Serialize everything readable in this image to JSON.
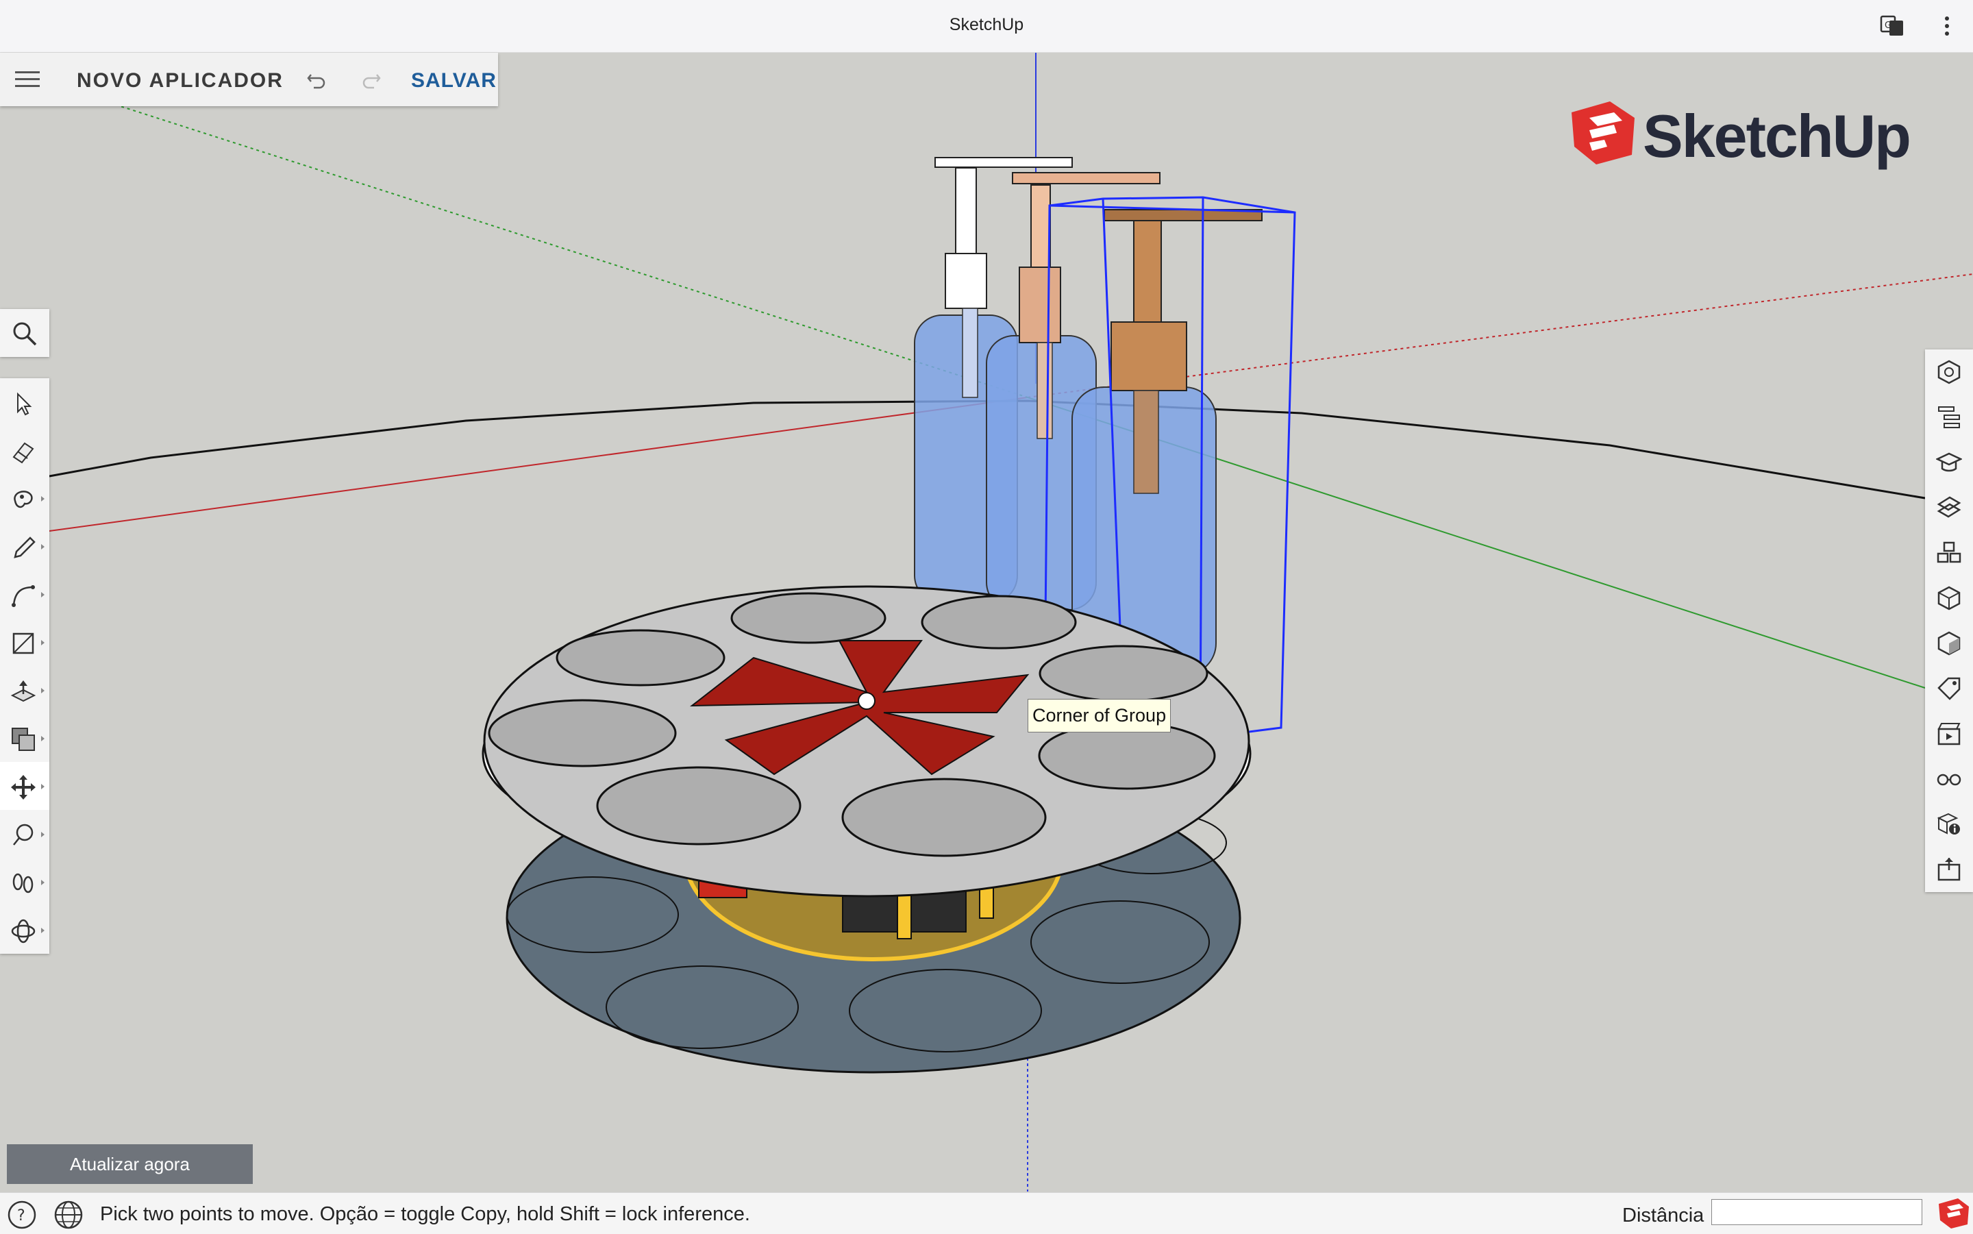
{
  "window": {
    "title": "SketchUp"
  },
  "toolbar": {
    "document_title": "NOVO APLICADOR",
    "save_label": "SALVAR",
    "menu_icon": "hamburger-menu-icon",
    "undo_icon": "undo-icon",
    "redo_icon": "redo-icon"
  },
  "logo": {
    "wordmark": "SketchUp"
  },
  "left_tools": {
    "search": "search-icon",
    "items": [
      {
        "name": "select-tool",
        "icon": "arrow-icon"
      },
      {
        "name": "eraser-tool",
        "icon": "eraser-icon"
      },
      {
        "name": "paint-bucket-tool",
        "icon": "paint-icon"
      },
      {
        "name": "pencil-tool",
        "icon": "pencil-icon"
      },
      {
        "name": "arc-tool",
        "icon": "arc-icon"
      },
      {
        "name": "rectangle-tool",
        "icon": "rectangle-icon"
      },
      {
        "name": "push-pull-tool",
        "icon": "push-pull-icon"
      },
      {
        "name": "offset-tool",
        "icon": "offset-icon"
      },
      {
        "name": "move-tool",
        "icon": "move-icon",
        "active": true
      },
      {
        "name": "tape-measure-tool",
        "icon": "tape-icon"
      },
      {
        "name": "walk-tool",
        "icon": "footprints-icon"
      },
      {
        "name": "orbit-tool",
        "icon": "orbit-icon"
      }
    ]
  },
  "right_panels": [
    "entity-info-icon",
    "outliner-icon",
    "instructor-icon",
    "materials-icon",
    "components-icon",
    "styles-icon",
    "shadows-icon",
    "tags-icon",
    "scenes-icon",
    "display-icon",
    "model-info-icon",
    "export-icon"
  ],
  "tooltip": {
    "text": "Corner of Group"
  },
  "update_button": {
    "label": "Atualizar agora"
  },
  "statusbar": {
    "message": "Pick two points to move. Opção = toggle Copy, hold Shift = lock inference.",
    "distance_label": "Distância",
    "distance_value": ""
  },
  "colors": {
    "accent": "#1f5d9a",
    "axis_red": "#c0262b",
    "axis_green": "#2f9a2f",
    "axis_blue": "#2a3be0",
    "selection_blue": "#1d2cff",
    "background": "#cfcfcb"
  }
}
